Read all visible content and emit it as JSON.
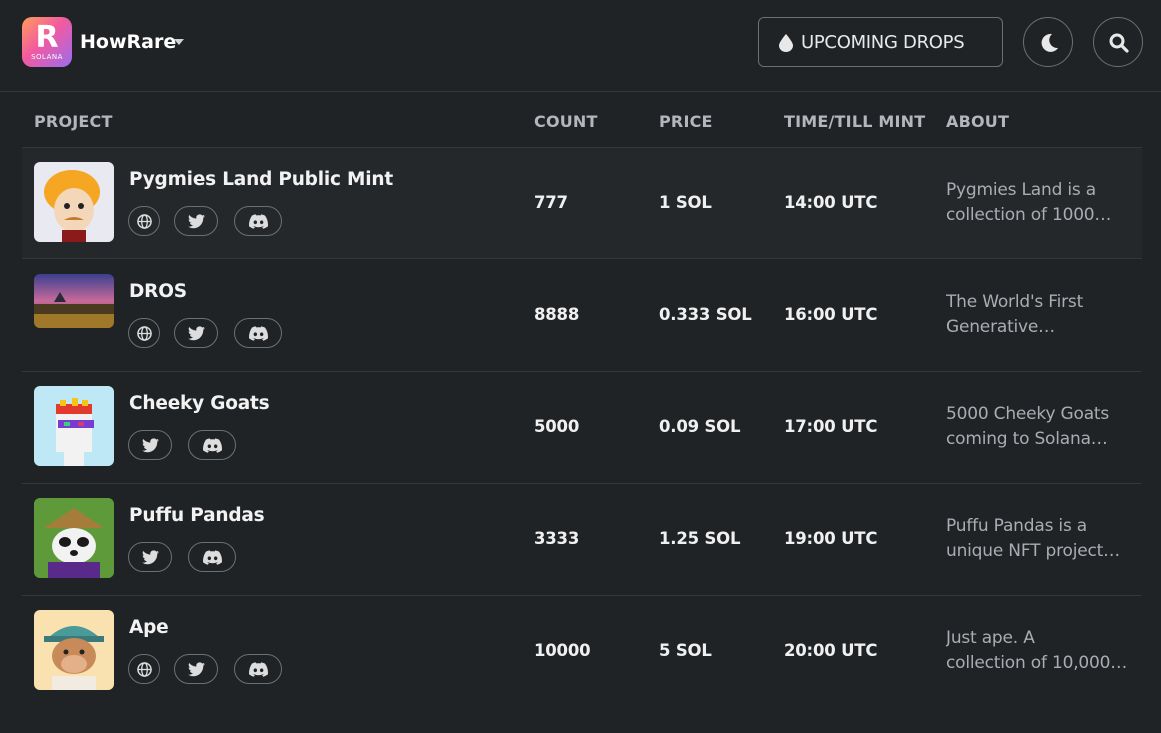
{
  "header": {
    "brand": "HowRare",
    "logo_letter": "R",
    "logo_sub": "SOLANA",
    "drops_button": "UPCOMING DROPS",
    "drop_icon": "drop-icon",
    "theme_icon": "moon-icon",
    "search_icon": "search-icon",
    "accent_gradient": [
      "#ff9c5a",
      "#f25aa0",
      "#9b6cf0"
    ]
  },
  "columns": {
    "project": "PROJECT",
    "count": "COUNT",
    "price": "PRICE",
    "time": "TIME/TILL MINT",
    "about": "ABOUT"
  },
  "rows": [
    {
      "name": "Pygmies Land Public Mint",
      "count": "777",
      "price": "1 SOL",
      "time": "14:00 UTC",
      "about_1": "Pygmies Land is a",
      "about_2": "collection of 1000…",
      "links": [
        "website",
        "twitter",
        "discord"
      ]
    },
    {
      "name": "DROS",
      "count": "8888",
      "price": "0.333 SOL",
      "time": "16:00 UTC",
      "about_1": "The World's First",
      "about_2": "Generative…",
      "links": [
        "website",
        "twitter",
        "discord"
      ]
    },
    {
      "name": "Cheeky Goats",
      "count": "5000",
      "price": "0.09 SOL",
      "time": "17:00 UTC",
      "about_1": "5000 Cheeky Goats",
      "about_2": "coming to Solana…",
      "links": [
        "twitter",
        "discord"
      ]
    },
    {
      "name": "Puffu Pandas",
      "count": "3333",
      "price": "1.25 SOL",
      "time": "19:00 UTC",
      "about_1": "Puffu Pandas is a",
      "about_2": "unique NFT project…",
      "links": [
        "twitter",
        "discord"
      ]
    },
    {
      "name": "Ape",
      "count": "10000",
      "price": "5 SOL",
      "time": "20:00 UTC",
      "about_1": "Just ape. A",
      "about_2": "collection of 10,000…",
      "links": [
        "website",
        "twitter",
        "discord"
      ]
    }
  ]
}
